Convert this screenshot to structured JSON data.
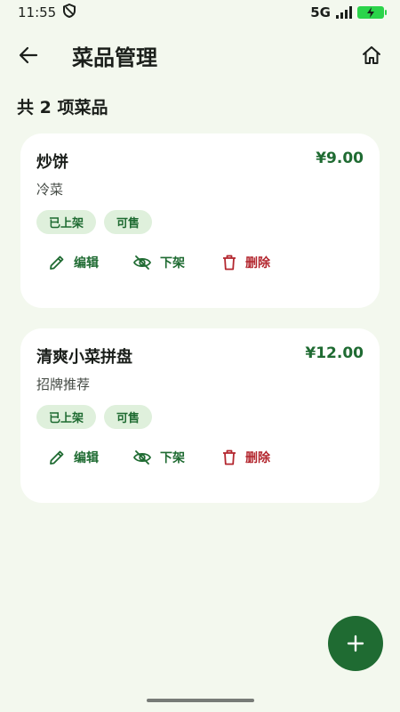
{
  "status_bar": {
    "time": "11:55",
    "network": "5G"
  },
  "app_bar": {
    "title": "菜品管理"
  },
  "summary": {
    "count_text": "共 2 项菜品"
  },
  "dishes": [
    {
      "name": "炒饼",
      "price": "¥9.00",
      "category": "冷菜",
      "badges": [
        "已上架",
        "可售"
      ],
      "actions": {
        "edit": "编辑",
        "offline": "下架",
        "delete": "删除"
      }
    },
    {
      "name": "清爽小菜拼盘",
      "price": "¥12.00",
      "category": "招牌推荐",
      "badges": [
        "已上架",
        "可售"
      ],
      "actions": {
        "edit": "编辑",
        "offline": "下架",
        "delete": "删除"
      }
    }
  ],
  "colors": {
    "background": "#f3f8ee",
    "primary": "#1f6b32",
    "danger": "#b3262e",
    "badge_bg": "#dff0dc",
    "battery": "#2bd44a"
  },
  "icons": {
    "back": "arrow-left-icon",
    "home": "home-icon",
    "edit": "pencil-icon",
    "offline": "eye-off-icon",
    "delete": "trash-icon",
    "fab": "plus-icon"
  }
}
